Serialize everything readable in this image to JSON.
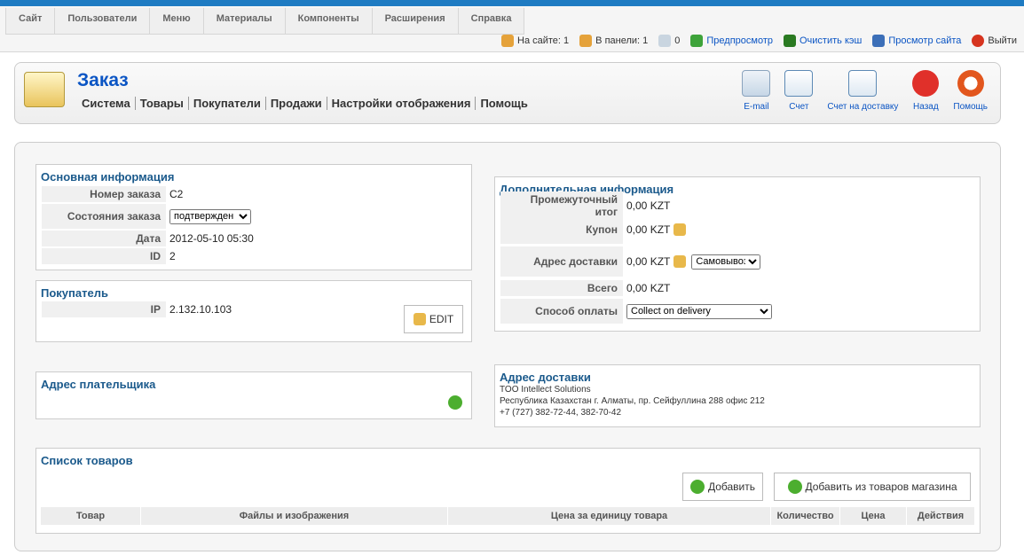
{
  "menu": [
    "Сайт",
    "Пользователи",
    "Меню",
    "Материалы",
    "Компоненты",
    "Расширения",
    "Справка"
  ],
  "status": {
    "online_label": "На сайте: 1",
    "panel_label": "В панели: 1",
    "messages": "0",
    "preview": "Предпросмотр",
    "clear_cache": "Очистить кэш",
    "view_site": "Просмотр сайта",
    "logout": "Выйти"
  },
  "page": {
    "title": "Заказ",
    "submenu": [
      "Система",
      "Товары",
      "Покупатели",
      "Продажи",
      "Настройки отображения",
      "Помощь"
    ]
  },
  "toolbar": {
    "email": "E-mail",
    "invoice": "Счет",
    "delivery_invoice": "Счет на доставку",
    "back": "Назад",
    "help": "Помощь"
  },
  "basic_info": {
    "title": "Основная информация",
    "order_no_label": "Номер заказа",
    "order_no": "C2",
    "state_label": "Состояния заказа",
    "state_value": "подтвержден",
    "date_label": "Дата",
    "date": "2012-05-10 05:30",
    "id_label": "ID",
    "id": "2"
  },
  "customer": {
    "title": "Покупатель",
    "ip_label": "IP",
    "ip": "2.132.10.103",
    "edit": "EDIT"
  },
  "extra_info": {
    "title": "Дополнительная информация",
    "subtotal_label": "Промежуточный итог",
    "subtotal": "0,00 KZT",
    "coupon_label": "Купон",
    "coupon": "0,00 KZT",
    "shipping_label": "Адрес доставки",
    "shipping": "0,00 KZT",
    "shipping_method": "Самовывоз",
    "total_label": "Всего",
    "total": "0,00 KZT",
    "payment_label": "Способ оплаты",
    "payment": "Collect on delivery"
  },
  "billing": {
    "title": "Адрес плательщика"
  },
  "delivery": {
    "title": "Адрес доставки",
    "line1": "TOO Intellect Solutions",
    "line2": "Республика Казахстан г. Алматы, пр. Сейфуллина 288 офис 212",
    "line3": "+7 (727) 382-72-44, 382-70-42"
  },
  "products": {
    "title": "Список товаров",
    "add": "Добавить",
    "add_from_store": "Добавить из товаров магазина",
    "columns": [
      "Товар",
      "Файлы и изображения",
      "Цена за единицу товара",
      "Количество",
      "Цена",
      "Действия"
    ]
  },
  "colors": {
    "accent": "#1b5a8c",
    "link": "#0b55c4",
    "topbar": "#1e7bc2"
  }
}
